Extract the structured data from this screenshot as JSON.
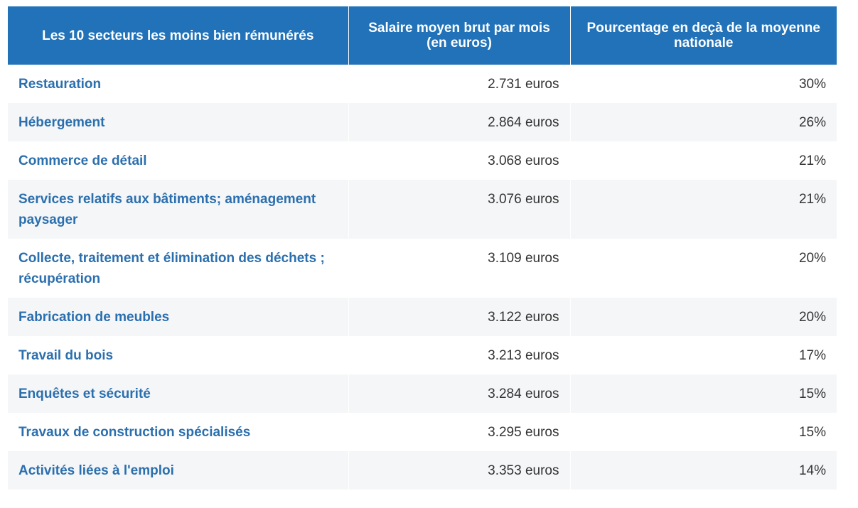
{
  "table": {
    "headers": [
      "Les 10 secteurs les moins bien rémunérés",
      "Salaire moyen brut par mois (en euros)",
      "Pourcentage en deçà de la moyenne nationale"
    ],
    "rows": [
      {
        "sector": "Restauration",
        "salary": "2.731 euros",
        "percent": "30%"
      },
      {
        "sector": "Hébergement",
        "salary": "2.864 euros",
        "percent": "26%"
      },
      {
        "sector": "Commerce de détail",
        "salary": "3.068 euros",
        "percent": "21%"
      },
      {
        "sector": "Services relatifs aux bâtiments; aménagement paysager",
        "salary": "3.076 euros",
        "percent": "21%"
      },
      {
        "sector": "Collecte, traitement et élimination des déchets ; récupération",
        "salary": "3.109 euros",
        "percent": "20%"
      },
      {
        "sector": "Fabrication de meubles",
        "salary": "3.122 euros",
        "percent": "20%"
      },
      {
        "sector": "Travail du bois",
        "salary": "3.213 euros",
        "percent": "17%"
      },
      {
        "sector": "Enquêtes et sécurité",
        "salary": "3.284 euros",
        "percent": "15%"
      },
      {
        "sector": "Travaux de construction spécialisés",
        "salary": "3.295 euros",
        "percent": "15%"
      },
      {
        "sector": "Activités liées à l'emploi",
        "salary": "3.353 euros",
        "percent": "14%"
      }
    ]
  },
  "colors": {
    "header_bg": "#2172b8",
    "header_text": "#ffffff",
    "sector_text": "#2b6fae",
    "value_text": "#333333",
    "stripe_bg": "#f4f6f8"
  }
}
